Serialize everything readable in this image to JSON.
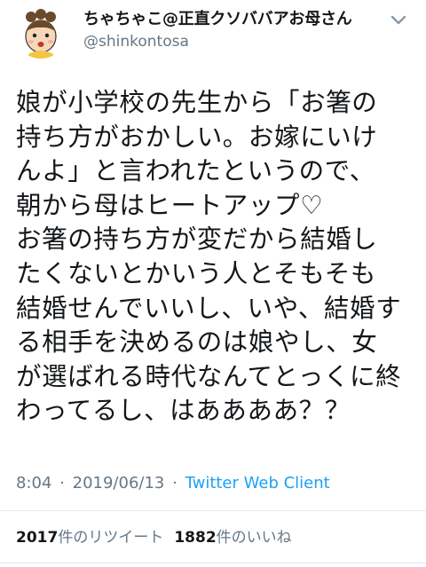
{
  "author": {
    "display_name": "ちゃちゃこ@正直クソババアお母さん",
    "handle": "@shinkontosa",
    "avatar_icon": "cartoon-face-avatar-icon"
  },
  "more_icon": "chevron-down-icon",
  "tweet_lines": [
    "娘が小学校の先生から「お箸の",
    "持ち方がおかしい。お嫁にいけ",
    "んよ」と言われたというので、",
    "朝から母はヒートアップ♡",
    "お箸の持ち方が変だから結婚し",
    "たくないとかいう人とそもそも",
    "結婚せんでいいし、いや、結婚す",
    "る相手を決めるのは娘やし、女",
    "が選ばれる時代なんてとっくに終",
    "わってるし、はああああ？？"
  ],
  "meta": {
    "time": "8:04",
    "date": "2019/06/13",
    "separator": "·",
    "client": "Twitter Web Client"
  },
  "stats": {
    "retweets_count": "2017",
    "retweets_label": "件のリツイート",
    "likes_count": "1882",
    "likes_label": "件のいいね"
  },
  "colors": {
    "text": "#14171a",
    "secondary": "#657786",
    "link": "#1da1f2",
    "divider": "#e1e8ed"
  }
}
